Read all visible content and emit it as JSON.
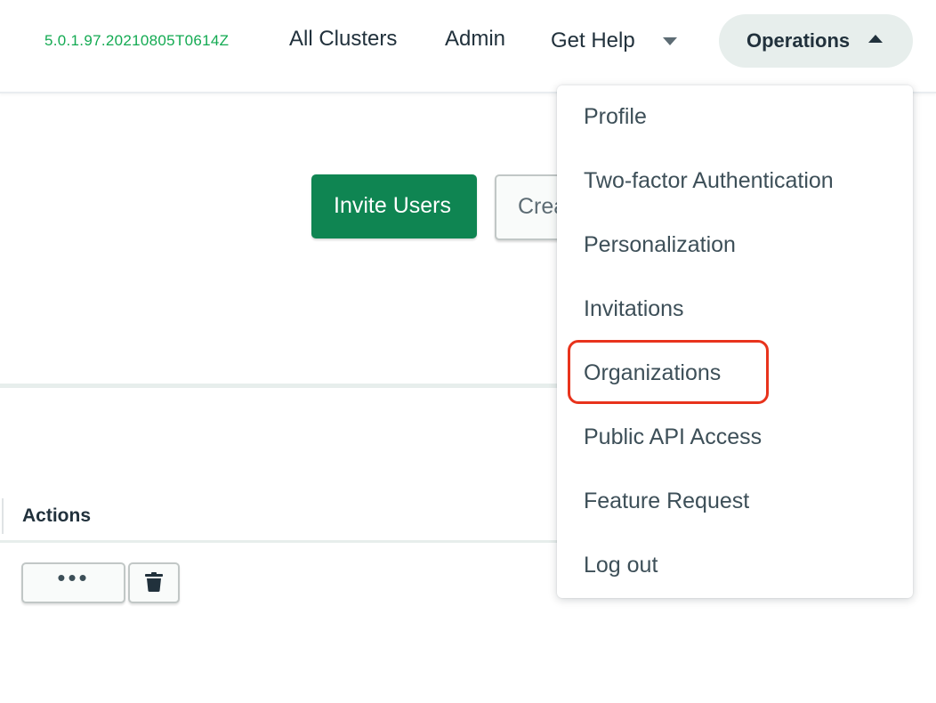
{
  "topnav": {
    "version": "5.0.1.97.20210805T0614Z",
    "links": {
      "all_clusters": "All Clusters",
      "admin": "Admin",
      "get_help": "Get Help"
    },
    "operations_label": "Operations"
  },
  "main": {
    "invite_users_label": "Invite Users",
    "create_label_partial": "Crea",
    "table": {
      "actions_header": "Actions",
      "more_label": "•••"
    }
  },
  "menu": {
    "items": [
      {
        "label": "Profile"
      },
      {
        "label": "Two-factor Authentication"
      },
      {
        "label": "Personalization"
      },
      {
        "label": "Invitations"
      },
      {
        "label": "Organizations",
        "highlighted": true
      },
      {
        "label": "Public API Access"
      },
      {
        "label": "Feature Request"
      },
      {
        "label": "Log out"
      }
    ]
  },
  "icons": {
    "caret_down": "caret-down-icon",
    "caret_up": "caret-up-icon",
    "trash": "trash-icon"
  },
  "colors": {
    "brand_green": "#0f8552",
    "version_green": "#13aa52",
    "highlight_red": "#e8331c",
    "ops_button_bg": "#e7eeec"
  }
}
